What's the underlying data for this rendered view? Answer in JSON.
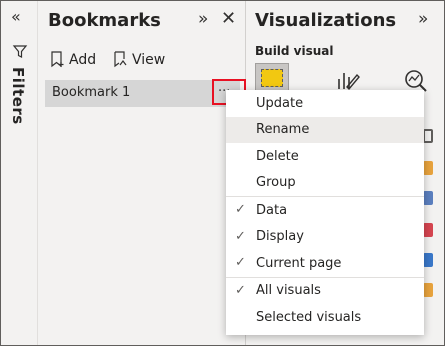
{
  "filters": {
    "collapse_icon": "chevron-double-left-icon",
    "label": "Filters",
    "icon": "funnel-icon"
  },
  "bookmarks": {
    "title": "Bookmarks",
    "add_label": "Add",
    "view_label": "View",
    "items": [
      {
        "label": "Bookmark 1"
      }
    ],
    "more_glyph": "..."
  },
  "visualizations": {
    "title": "Visualizations",
    "section": "Build visual"
  },
  "context_menu": {
    "groups": [
      [
        {
          "label": "Update",
          "checked": false
        },
        {
          "label": "Rename",
          "checked": false,
          "hovered": true
        },
        {
          "label": "Delete",
          "checked": false
        },
        {
          "label": "Group",
          "checked": false
        }
      ],
      [
        {
          "label": "Data",
          "checked": true
        },
        {
          "label": "Display",
          "checked": true
        },
        {
          "label": "Current page",
          "checked": true
        }
      ],
      [
        {
          "label": "All visuals",
          "checked": true
        },
        {
          "label": "Selected visuals",
          "checked": false
        }
      ]
    ]
  },
  "colors": {
    "highlight": "#e81123",
    "accent": "#f2c811",
    "pane_bg": "#f3f2f1",
    "selected_item": "#d6d6d6"
  }
}
